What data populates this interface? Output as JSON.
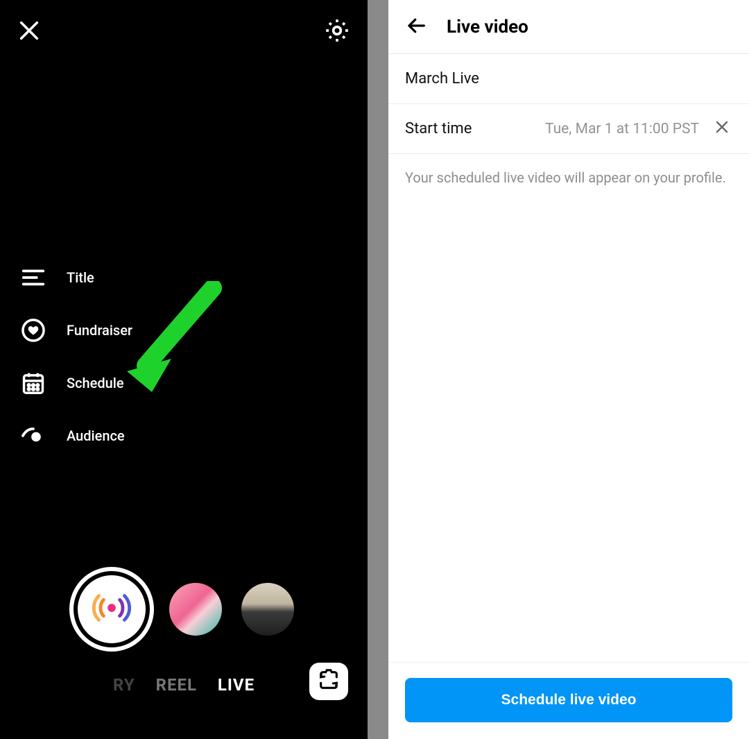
{
  "left": {
    "options": [
      {
        "label": "Title"
      },
      {
        "label": "Fundraiser"
      },
      {
        "label": "Schedule"
      },
      {
        "label": "Audience"
      }
    ],
    "modes": {
      "prev_partial": "RY",
      "prev": "REEL",
      "active": "LIVE"
    }
  },
  "right": {
    "header_title": "Live video",
    "event_title": "March Live",
    "start_label": "Start time",
    "start_value": "Tue, Mar 1 at 11:00 PST",
    "note": "Your scheduled live video will appear on your profile.",
    "cta": "Schedule live video"
  },
  "annotation": {
    "arrow_target": "schedule-option",
    "arrow_color": "#1fd22b"
  }
}
